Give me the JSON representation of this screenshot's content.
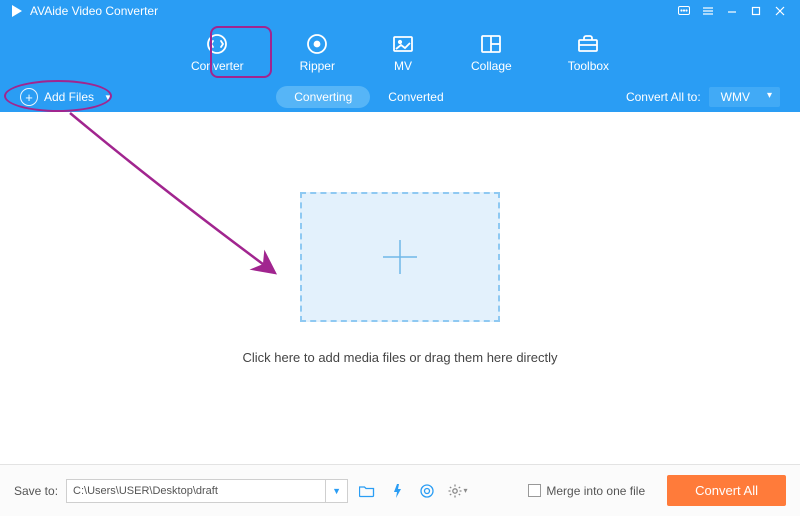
{
  "app": {
    "title": "AVAide Video Converter"
  },
  "nav": {
    "converter": "Converter",
    "ripper": "Ripper",
    "mv": "MV",
    "collage": "Collage",
    "toolbox": "Toolbox"
  },
  "subbar": {
    "add_files": "Add Files",
    "converting": "Converting",
    "converted": "Converted",
    "convert_all_to": "Convert All to:",
    "format_selected": "WMV"
  },
  "workspace": {
    "drop_text": "Click here to add media files or drag them here directly"
  },
  "footer": {
    "save_to_label": "Save to:",
    "save_path": "C:\\Users\\USER\\Desktop\\draft",
    "merge_label": "Merge into one file",
    "convert_all": "Convert All"
  }
}
